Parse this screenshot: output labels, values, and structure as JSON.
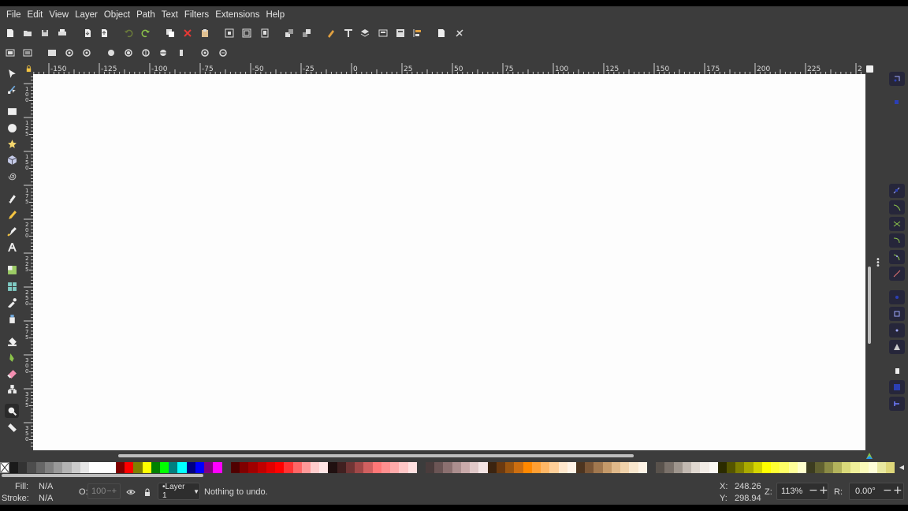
{
  "menu": [
    "File",
    "Edit",
    "View",
    "Layer",
    "Object",
    "Path",
    "Text",
    "Filters",
    "Extensions",
    "Help"
  ],
  "ruler": {
    "h_labels": [
      "-150",
      "-125",
      "-100",
      "-75",
      "-50",
      "-25",
      "0",
      "25",
      "50",
      "75",
      "100",
      "125",
      "150",
      "175",
      "200",
      "225",
      "2"
    ],
    "v_labels": [
      "1\n0\n0",
      "1\n2\n5",
      "1\n5\n0",
      "1\n7\n5",
      "2\n0\n0",
      "2\n2\n5",
      "2\n5\n0",
      "2\n7\n5",
      "3\n0\n0",
      "3\n2\n5",
      "3\n5\n0"
    ]
  },
  "status": {
    "fill_label": "Fill:",
    "fill_value": "N/A",
    "stroke_label": "Stroke:",
    "stroke_value": "N/A",
    "opacity_label": "O:",
    "opacity_value": "100",
    "opacity_minus": "−",
    "opacity_plus": "+",
    "layer": "•Layer 1",
    "message": "Nothing to undo.",
    "x_label": "X:",
    "x_value": "248.26",
    "y_label": "Y:",
    "y_value": "298.94",
    "zoom_label": "Z:",
    "zoom_value": "113%",
    "rotate_label": "R:",
    "rotate_value": "0.00°",
    "minus": "−",
    "plus": "+"
  },
  "colors": {
    "background": "#3c3c3c",
    "canvas": "#fdfdfd",
    "snap_active": "#26263a",
    "snap_accent": "#2b3fb5"
  },
  "palette": [
    "#1a1a1a",
    "#333333",
    "#4d4d4d",
    "#666666",
    "#808080",
    "#999999",
    "#b3b3b3",
    "#cccccc",
    "#e6e6e6",
    "#ffffff",
    "#ffffff",
    "#ffffff",
    "#800000",
    "#ff0000",
    "#808000",
    "#ffff00",
    "#008000",
    "#00ff00",
    "#008080",
    "#00ffff",
    "#000080",
    "#0000ff",
    "#800080",
    "#ff00ff",
    "#3c3c3c",
    "#500000",
    "#800000",
    "#a00000",
    "#c00000",
    "#e00000",
    "#ff0000",
    "#ff3333",
    "#ff6666",
    "#ff9999",
    "#ffcccc",
    "#ffe5e5",
    "#201010",
    "#402020",
    "#703535",
    "#a04848",
    "#d06060",
    "#ff7777",
    "#ff8f8f",
    "#ffaaaa",
    "#ffc6c6",
    "#ffe0e0",
    "#3c3c3c",
    "#4a3c3c",
    "#6b5555",
    "#8b7070",
    "#ab8e8e",
    "#c9aaaa",
    "#e0c8c8",
    "#f3e4e4",
    "#3b2410",
    "#6b3a10",
    "#9a5510",
    "#cc6e10",
    "#ff8800",
    "#ff9f33",
    "#ffb766",
    "#ffcf99",
    "#ffe7cc",
    "#fff3e6",
    "#4d3520",
    "#7a5636",
    "#a1784f",
    "#c59a6a",
    "#e0b98a",
    "#f0d2ab",
    "#f8e6cd",
    "#fdf3e6",
    "#3c3c3c",
    "#59524c",
    "#7a716a",
    "#9e958d",
    "#c2b9b1",
    "#e0d8d0",
    "#f2ece6",
    "#fbf8f4",
    "#2b2b00",
    "#555500",
    "#808000",
    "#aaaa00",
    "#d4d400",
    "#ffff00",
    "#ffff33",
    "#ffff66",
    "#ffff99",
    "#ffffcc",
    "#3c3c20",
    "#606030",
    "#8a8a45",
    "#b3b35c",
    "#d9d97a",
    "#f0f09a",
    "#fafaba",
    "#fdfdd8",
    "#e8e8a0",
    "#ded77a"
  ],
  "tools": [
    "selector",
    "node",
    "rect",
    "ellipse",
    "star",
    "3dbox",
    "spiral",
    "pen",
    "pencil",
    "calligraphy",
    "text",
    "gradient",
    "mesh",
    "dropper",
    "spray",
    "bucket",
    "tweak",
    "eraser",
    "connector",
    "zoom",
    "measure"
  ],
  "icons": {
    "lock": "lock-icon",
    "kebab": "more-icon",
    "palette_scroll": "chevron-left-icon"
  }
}
